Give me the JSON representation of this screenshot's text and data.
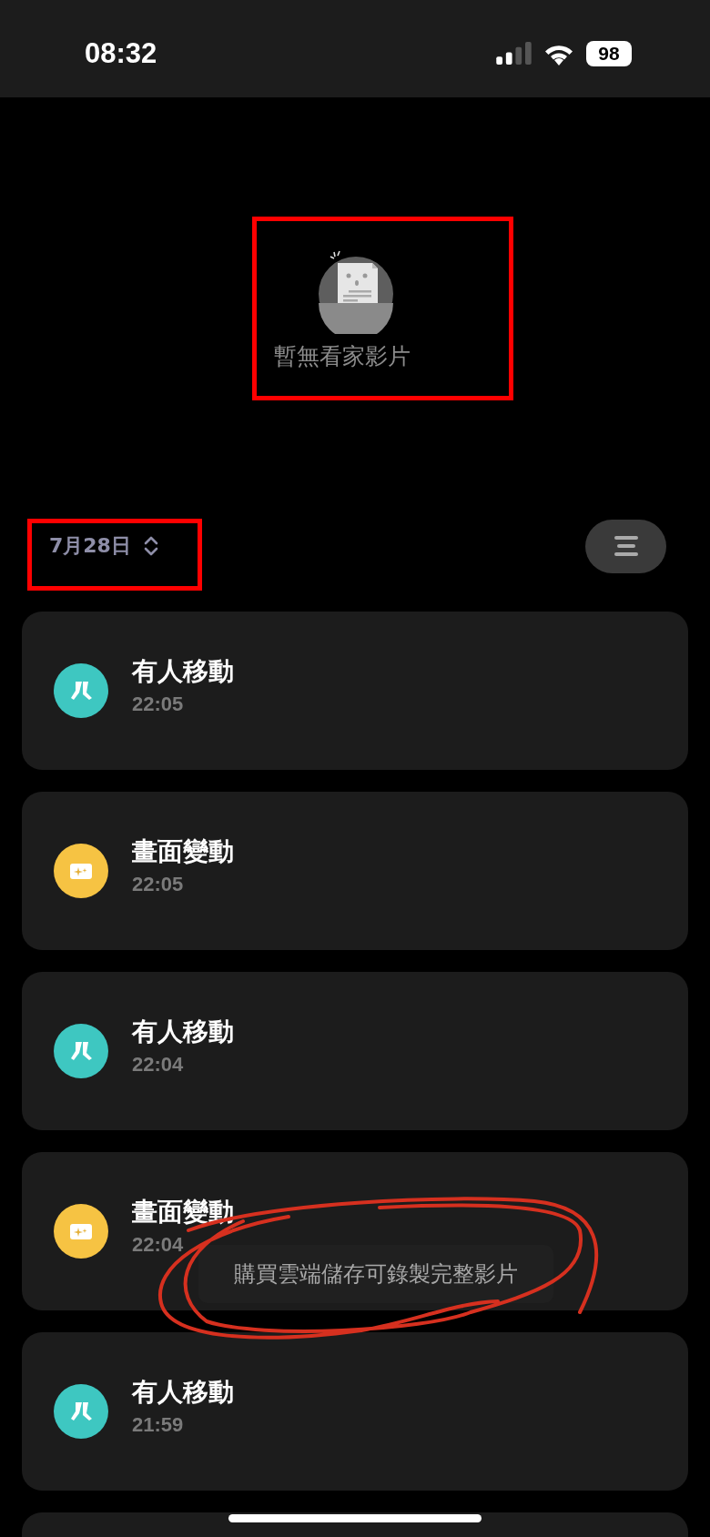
{
  "status_bar": {
    "time": "08:32",
    "battery": "98"
  },
  "empty_state": {
    "message": "暫無看家影片"
  },
  "date_picker": {
    "label": "7月28日"
  },
  "events": [
    {
      "kind": "person",
      "title": "有人移動",
      "time": "22:05"
    },
    {
      "kind": "screen_change",
      "title": "畫面變動",
      "time": "22:05"
    },
    {
      "kind": "person",
      "title": "有人移動",
      "time": "22:04"
    },
    {
      "kind": "screen_change",
      "title": "畫面變動",
      "time": "22:04"
    },
    {
      "kind": "person",
      "title": "有人移動",
      "time": "21:59"
    }
  ],
  "toast": {
    "message": "購買雲端儲存可錄製完整影片"
  }
}
